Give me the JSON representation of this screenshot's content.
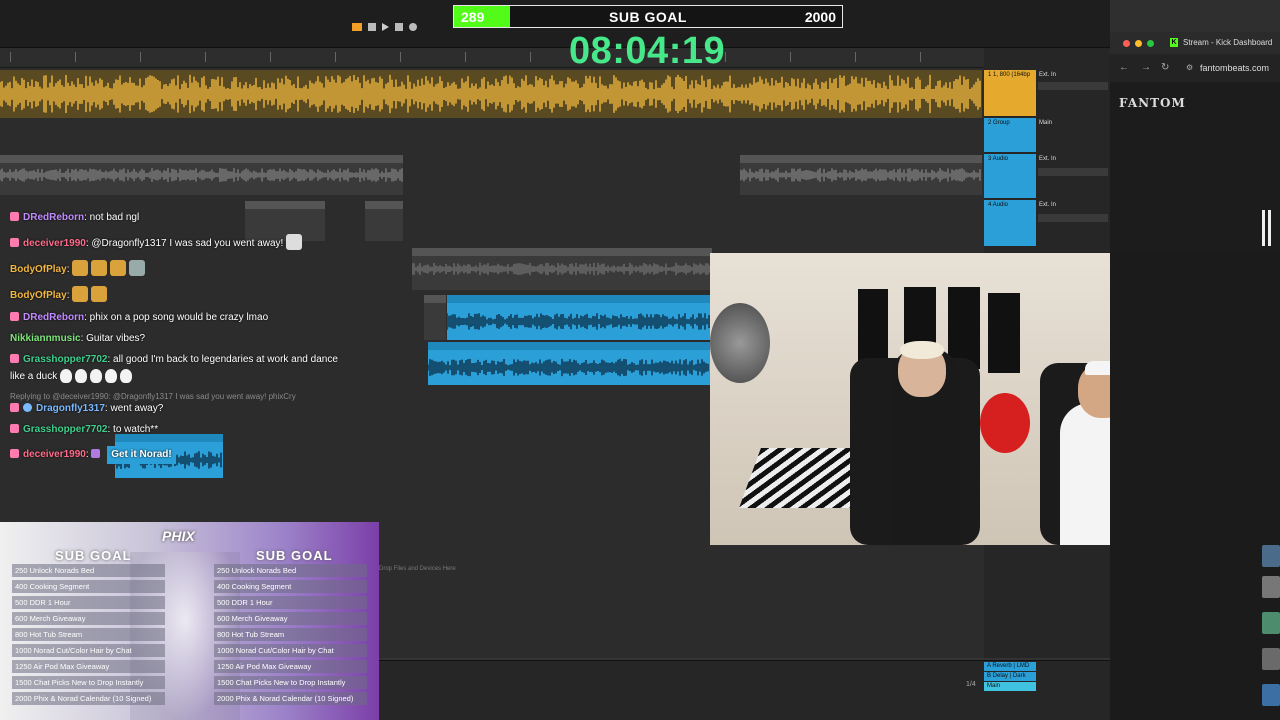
{
  "sub_goal_bar": {
    "current": "289",
    "label": "SUB GOAL",
    "target": "2000",
    "progress_fraction": 0.1445,
    "fill_color": "#53fc18"
  },
  "timer": "08:04:19",
  "chat": [
    {
      "user": "DRedReborn",
      "text": ": not bad ngl",
      "color": "#c08bff"
    },
    {
      "user": "deceiver1990",
      "text": ": @Dragonfly1317 I was sad you went away!",
      "color": "#ff6b8a"
    },
    {
      "user": "BodyOfPlay",
      "text": ":",
      "color": "#f2b740"
    },
    {
      "user": "BodyOfPlay",
      "text": ":",
      "color": "#f2b740"
    },
    {
      "user": "DRedReborn",
      "text": ": phix on a pop song would be crazy lmao",
      "color": "#c08bff"
    },
    {
      "user": "Nikkiannmusic",
      "text": ": Guitar vibes?",
      "color": "#7de37a"
    },
    {
      "user": "Grasshopper7702",
      "text": ": all good I'm back to legendaries at work and dance",
      "continuation": "like a duck",
      "color": "#3fcf8e"
    },
    {
      "user": "Dragonfly1317",
      "text": ": went away?",
      "color": "#7ab8ff"
    },
    {
      "user": "Grasshopper7702",
      "text": ": to watch**",
      "color": "#3fcf8e"
    },
    {
      "user": "deceiver1990",
      "text": ":",
      "highlight": "Get it Norad!",
      "color": "#ff6b8a"
    }
  ],
  "reply_context": "Replying to @deceiver1990: @Dragonfly1317 I was sad you went away! phixCry",
  "goals_panel": {
    "logo": "PHIX",
    "left_title": "SUB GOAL",
    "right_title": "SUB GOAL",
    "items": [
      "250 Unlock Norads Bed",
      "400 Cooking Segment",
      "500 DDR 1 Hour",
      "600 Merch Giveaway",
      "800 Hot Tub Stream",
      "1000 Norad Cut/Color Hair by Chat",
      "1250 Air Pod Max Giveaway",
      "1500 Chat Picks New to Drop Instantly",
      "2000 Phix & Norad Calendar (10 Signed)"
    ]
  },
  "daw": {
    "drop_hint": "Drop Files and Devices Here",
    "tracks": [
      {
        "name": "1 1, 800 (164bp",
        "input": "Ext. In",
        "color": "#e5a92e"
      },
      {
        "name": "2 Group",
        "input": "Main",
        "color": "#2a9fd8"
      },
      {
        "name": "3 Audio",
        "input": "Ext. In",
        "color": "#2a9fd8"
      },
      {
        "name": "4 Audio",
        "input": "Ext. In",
        "color": "#2a9fd8"
      }
    ],
    "returns": [
      "A Reverb | LMD",
      "B Delay | Dark",
      "Main"
    ],
    "bar_counter": "1/4"
  },
  "browser": {
    "tab_title": "Stream - Kick Dashboard",
    "url": "fantombeats.com",
    "site_logo": "FANTOM"
  }
}
